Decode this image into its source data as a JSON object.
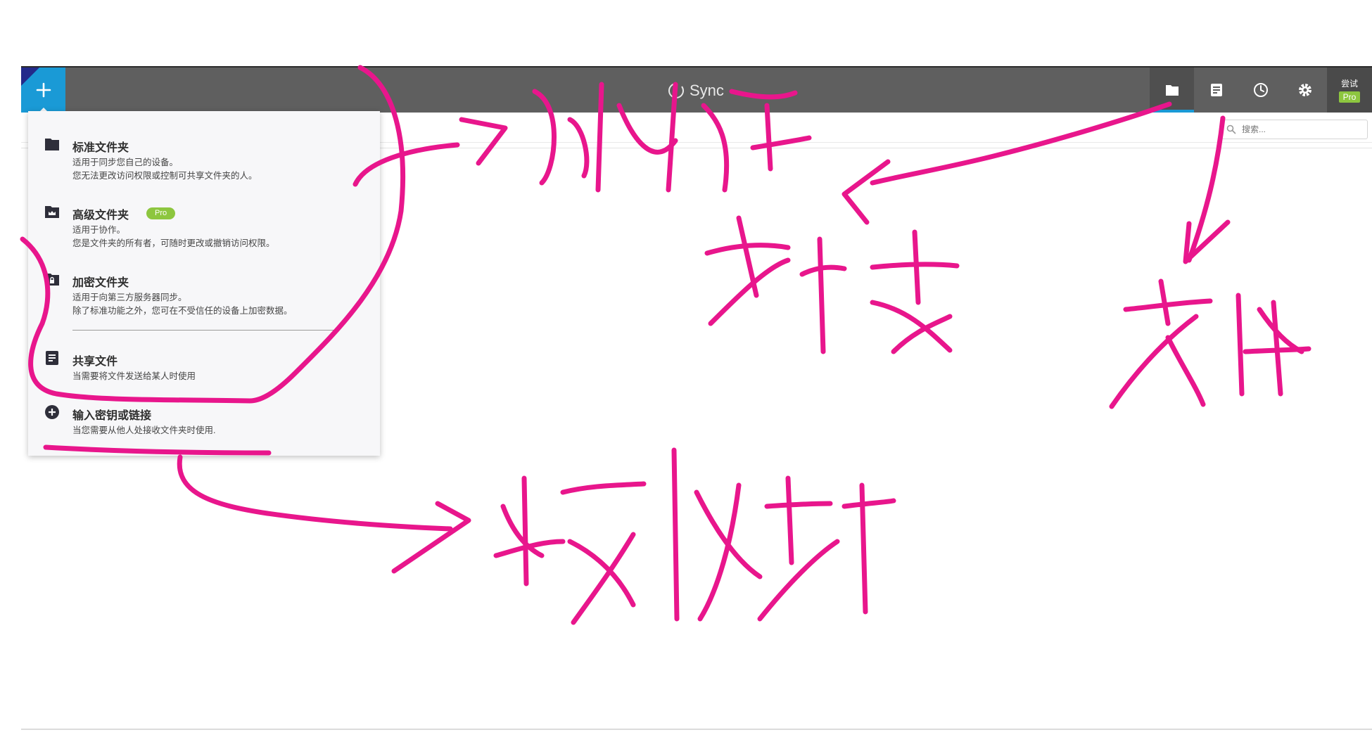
{
  "app": {
    "brand": "Sync"
  },
  "header": {
    "add_icon": "plus-icon",
    "nav": [
      {
        "name": "folders",
        "icon": "folder-icon",
        "active": true
      },
      {
        "name": "files",
        "icon": "file-icon"
      },
      {
        "name": "history",
        "icon": "clock-icon"
      },
      {
        "name": "settings",
        "icon": "gear-icon"
      }
    ],
    "trial_label": "尝试",
    "pro_label": "Pro",
    "accent_color": "#1a9ad6",
    "pro_color": "#8dc63f"
  },
  "search": {
    "placeholder": "搜索..."
  },
  "menu": {
    "items": [
      {
        "title": "标准文件夹",
        "desc1": "适用于同步您自己的设备。",
        "desc2": "您无法更改访问权限或控制可共享文件夹的人。",
        "icon": "folder-icon"
      },
      {
        "title": "高级文件夹",
        "badge": "Pro",
        "desc1": "适用于协作。",
        "desc2": "您是文件夹的所有者，可随时更改或撤销访问权限。",
        "icon": "crown-folder-icon"
      },
      {
        "title": "加密文件夹",
        "desc1": "适用于向第三方服务器同步。",
        "desc2": "除了标准功能之外，您可在不受信任的设备上加密数据。",
        "icon": "lock-folder-icon"
      },
      {
        "title": "共享文件",
        "desc1": "当需要将文件发送给某人时使用",
        "icon": "document-icon"
      },
      {
        "title": "输入密钥或链接",
        "desc1": "当您需要从他人处接收文件夹时使用.",
        "icon": "plus-circle-icon"
      }
    ]
  },
  "annotation_color": "#e8168c"
}
